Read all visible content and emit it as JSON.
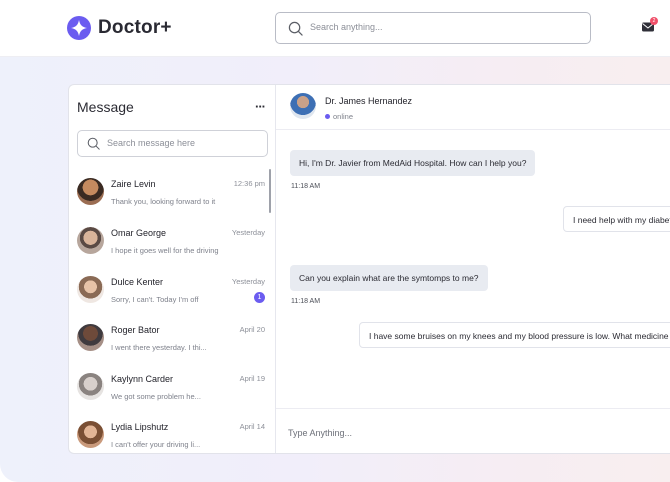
{
  "app": {
    "name": "Doctor+",
    "brand_color": "#6b5cf0"
  },
  "header": {
    "search_placeholder": "Search anything...",
    "mail_icon": "mail-icon",
    "mail_badge": "2"
  },
  "sidebar": {
    "title": "Message",
    "more_label": "···",
    "search_placeholder": "Search message here",
    "contacts": [
      {
        "name": "Zaire Levin",
        "time": "12:36 pm",
        "preview": "Thank you, looking forward to it",
        "badge": ""
      },
      {
        "name": "Omar George",
        "time": "Yesterday",
        "preview": "I hope it goes well for the driving",
        "badge": ""
      },
      {
        "name": "Dulce Kenter",
        "time": "Yesterday",
        "preview": "Sorry, I can't. Today I'm off",
        "badge": "1"
      },
      {
        "name": "Roger Bator",
        "time": "April 20",
        "preview": "I went there yesterday. I thi...",
        "badge": ""
      },
      {
        "name": "Kaylynn Carder",
        "time": "April 19",
        "preview": "We got some problem he...",
        "badge": ""
      },
      {
        "name": "Lydia Lipshutz",
        "time": "April 14",
        "preview": "I can't offer your driving li...",
        "badge": ""
      }
    ]
  },
  "chat": {
    "doctor_name": "Dr. James Hernandez",
    "status": "online",
    "messages": [
      {
        "direction": "in",
        "text": "Hi, I'm Dr. Javier from MedAid Hospital. How can I help you?",
        "time": "11:18 AM"
      },
      {
        "direction": "out",
        "text": "I need help with my diabetes",
        "time": ""
      },
      {
        "direction": "in",
        "text": "Can you explain what are the symtomps to me?",
        "time": "11:18 AM"
      },
      {
        "direction": "out",
        "text": "I have some bruises on my knees and my blood pressure is low. What medicine should I take?",
        "time": ""
      }
    ],
    "composer_placeholder": "Type Anything..."
  }
}
